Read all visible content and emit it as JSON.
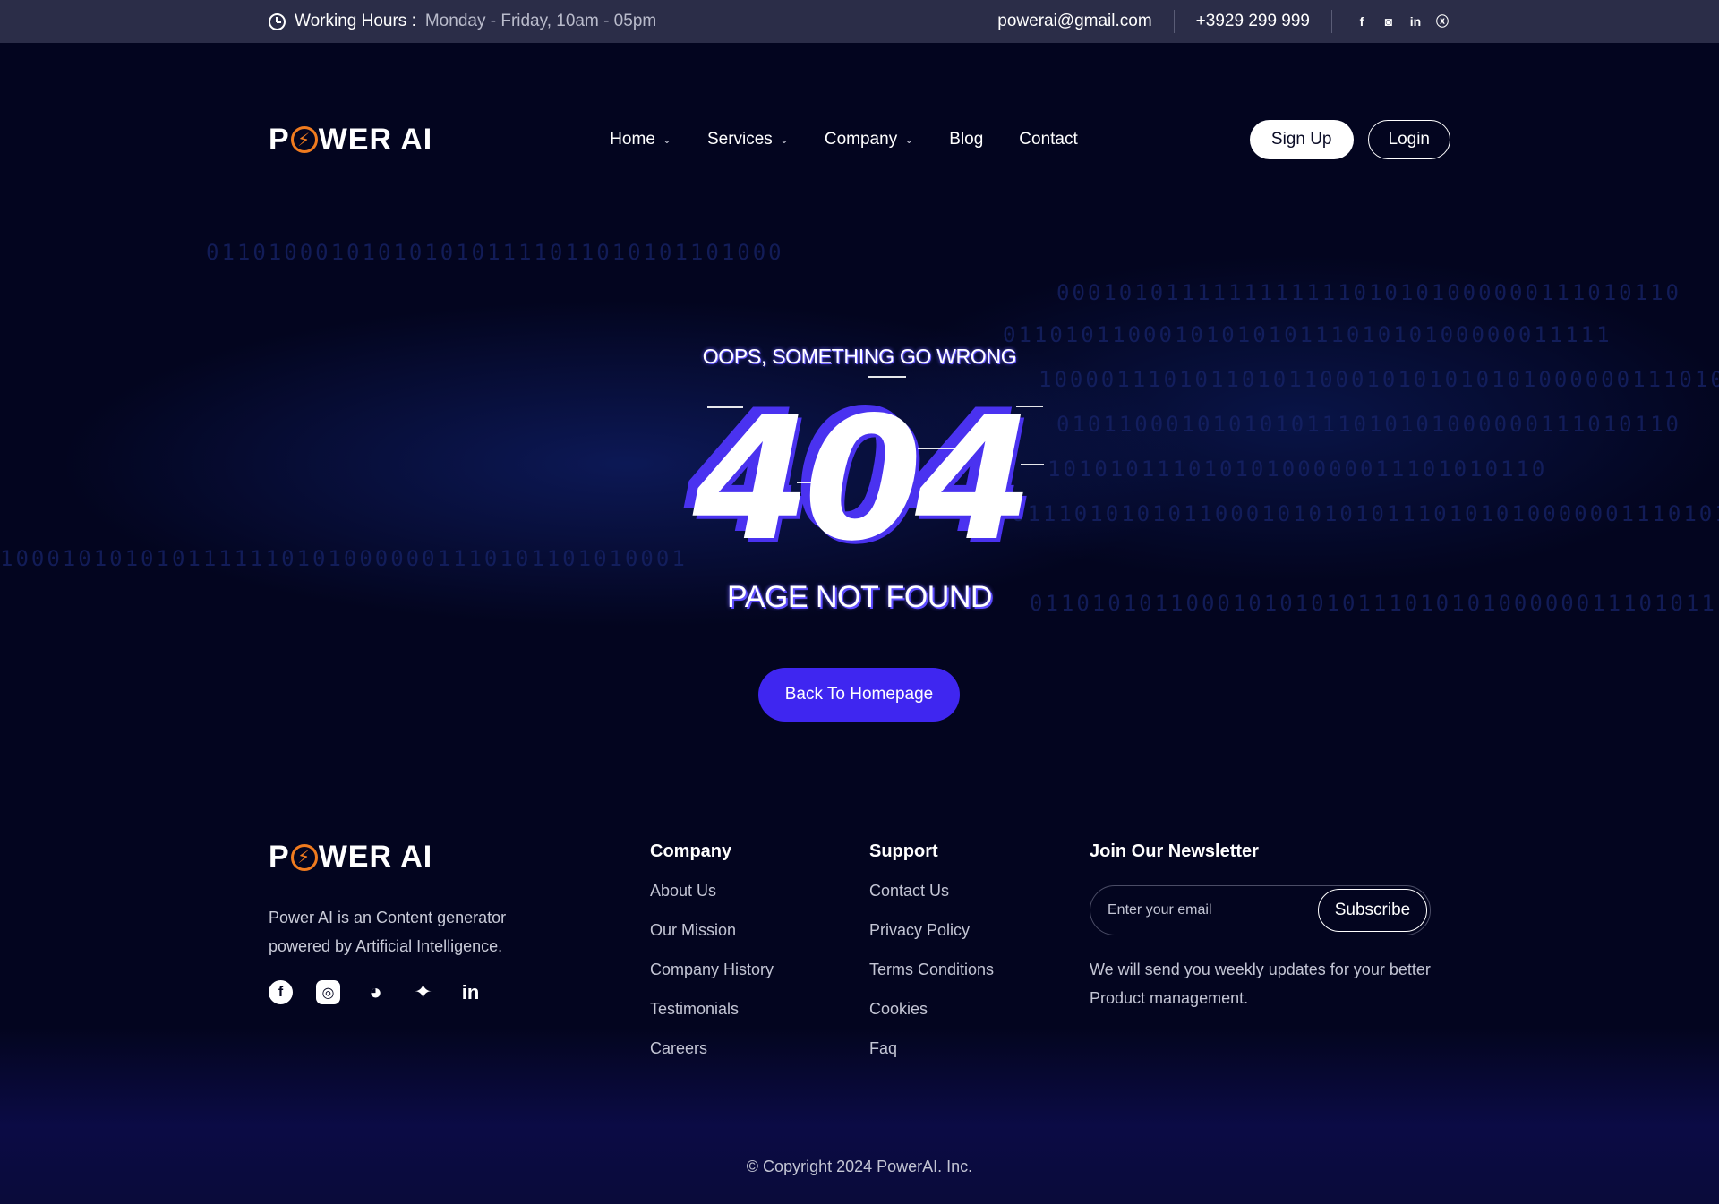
{
  "topbar": {
    "hours_label": "Working Hours :",
    "hours_value": "Monday - Friday, 10am - 05pm",
    "email": "powerai@gmail.com",
    "phone": "+3929 299 999",
    "socials": [
      "facebook-icon",
      "instagram-icon",
      "linkedin-icon",
      "x-icon"
    ]
  },
  "brand": {
    "logo_prefix": "P",
    "logo_bolt": "⚡",
    "logo_suffix": "WER AI"
  },
  "nav": {
    "items": [
      {
        "label": "Home",
        "has_dropdown": true
      },
      {
        "label": "Services",
        "has_dropdown": true
      },
      {
        "label": "Company",
        "has_dropdown": true
      },
      {
        "label": "Blog",
        "has_dropdown": false
      },
      {
        "label": "Contact",
        "has_dropdown": false
      }
    ],
    "signup": "Sign Up",
    "login": "Login"
  },
  "error": {
    "oops": "OOPS, SOMETHING GO WRONG",
    "code": "404",
    "message": "PAGE NOT FOUND",
    "button": "Back To Homepage"
  },
  "footer": {
    "about": "Power AI is an Content generator powered by Artificial Intelligence.",
    "socials": [
      "facebook-icon",
      "instagram-icon",
      "discord-icon",
      "twitter-icon",
      "linkedin-icon"
    ],
    "company": {
      "title": "Company",
      "links": [
        "About Us",
        "Our Mission",
        "Company History",
        "Testimonials",
        "Careers"
      ]
    },
    "support": {
      "title": "Support",
      "links": [
        "Contact Us",
        "Privacy Policy",
        "Terms Conditions",
        "Cookies",
        "Faq"
      ]
    },
    "newsletter": {
      "title": "Join Our Newsletter",
      "placeholder": "Enter your email",
      "button": "Subscribe",
      "note": "We will send you weekly updates for your better Product management."
    },
    "copyright": "© Copyright 2024 PowerAI. Inc."
  },
  "colors": {
    "background": "#03051f",
    "topbar": "#2b2d48",
    "accent": "#3f26f0",
    "logo_bolt": "#f07b1f"
  }
}
